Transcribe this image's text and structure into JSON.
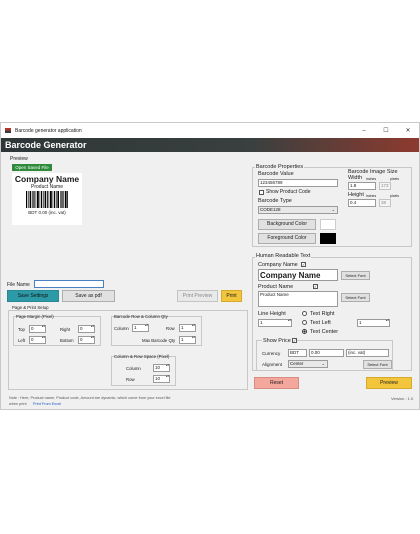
{
  "window": {
    "title": "Barcode generator application",
    "banner": "Barcode Generator",
    "controls": {
      "minimize": "–",
      "maximize": "☐",
      "close": "✕"
    }
  },
  "preview": {
    "label": "Preview",
    "open_saved_file": "Open Saved File",
    "company_name": "Company Name",
    "product_name": "Product Name",
    "price_line": "BDT 0.00 (inc. vat)"
  },
  "file": {
    "label": "File Name",
    "value": "",
    "save_settings": "Save Settings",
    "save_as_pdf": "Save as pdf",
    "print_preview": "Print Preview",
    "print": "Print"
  },
  "page_setup": {
    "title": "Page & Print Setup",
    "margin_title": "Page Margin (Pixel)",
    "top_label": "Top",
    "top": "0",
    "right_label": "Right",
    "right": "0",
    "left_label": "Left",
    "left": "0",
    "bottom_label": "Bottom",
    "bottom": "0",
    "rowcol_title": "Barcode Row & Column Qty",
    "column_label": "Column",
    "column": "1",
    "row_label": "Row",
    "row": "1",
    "max_qty_label": "Max Barcode Qty",
    "max_qty": "1",
    "space_title": "Column & Row Space (Pixel)",
    "space_column_label": "Column",
    "space_column": "10",
    "space_row_label": "Row",
    "space_row": "10"
  },
  "note": {
    "text": "Note : Here, Product name, Product code, Amount are dynamic, which come from your excel file",
    "text2": "when print",
    "link": "Print From Excel"
  },
  "version": "Version : 1.0",
  "barcode_props": {
    "title": "Barcode Properties",
    "value_label": "Barcode Value",
    "value": "123456789",
    "show_product_code": "Show Product Code",
    "type_label": "Barcode Type",
    "type": "CODE128",
    "image_size_title": "Barcode Image Size",
    "width_label": "Width",
    "units_inches": "inches",
    "units_pixels": "pixels",
    "width_in": "1.8",
    "width_px": "173",
    "height_label": "Height",
    "height_in": "0.4",
    "height_px": "38",
    "background_color": "Background Color",
    "foreground_color": "Foreground Color",
    "bg_swatch": "#ffffff",
    "fg_swatch": "#000000"
  },
  "human_readable": {
    "title": "Human Readable  Text",
    "company_label": "Company Name",
    "company_value": "Company Name",
    "select_font": "Select Font",
    "product_label": "Product Name",
    "product_value": "Product Name",
    "line_height_label": "Line Height",
    "line_height": "1",
    "text_right": "Text Right",
    "text_left": "Text Left",
    "text_center": "Text Center",
    "align_value": "1",
    "show_price": "Show Price",
    "currency_label": "Currency",
    "currency": "BDT",
    "amount": "0.00",
    "suffix": "(inc. vat)",
    "alignment_label": "Alignment",
    "alignment": "Center"
  },
  "actions": {
    "reset": "Reset",
    "preview": "Preview",
    "reset_color": "#f4a79d",
    "preview_color": "#f2c53d",
    "accent_teal": "#2d9aa8",
    "green": "#2e8b3a"
  }
}
